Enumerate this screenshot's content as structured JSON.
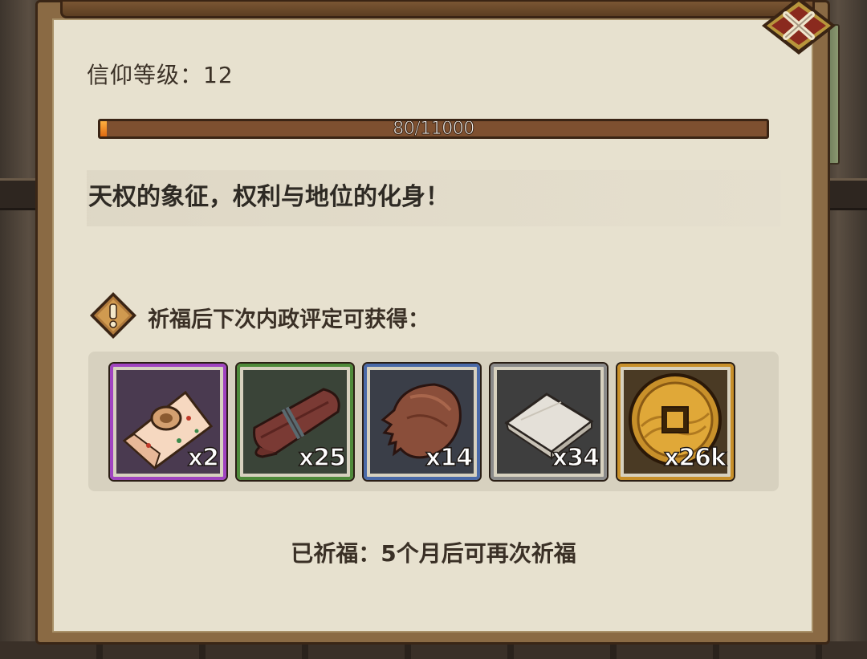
{
  "faith": {
    "label": "信仰等级：12",
    "progress_text": "80/11000",
    "progress_fraction": 0.0073
  },
  "description": "天权的象征，权利与地位的化身！",
  "rewards": {
    "label": "祈福后下次内政评定可获得：",
    "items": [
      {
        "icon": "brocade-scroll-icon",
        "count": "x2",
        "rarity_color": "#a044c0"
      },
      {
        "icon": "leather-strap-icon",
        "count": "x25",
        "rarity_color": "#4e8a3a"
      },
      {
        "icon": "fur-pelt-icon",
        "count": "x14",
        "rarity_color": "#4a6aa8"
      },
      {
        "icon": "cloth-fabric-icon",
        "count": "x34",
        "rarity_color": "#8a8a8a"
      },
      {
        "icon": "copper-coin-icon",
        "count": "x26k",
        "rarity_color": "#c8902a"
      }
    ]
  },
  "status": "已祈福：5个月后可再次祈福",
  "colors": {
    "panel_bg": "#e7e1cf",
    "progress_fill": "#e06a10",
    "text": "#3a3026"
  }
}
